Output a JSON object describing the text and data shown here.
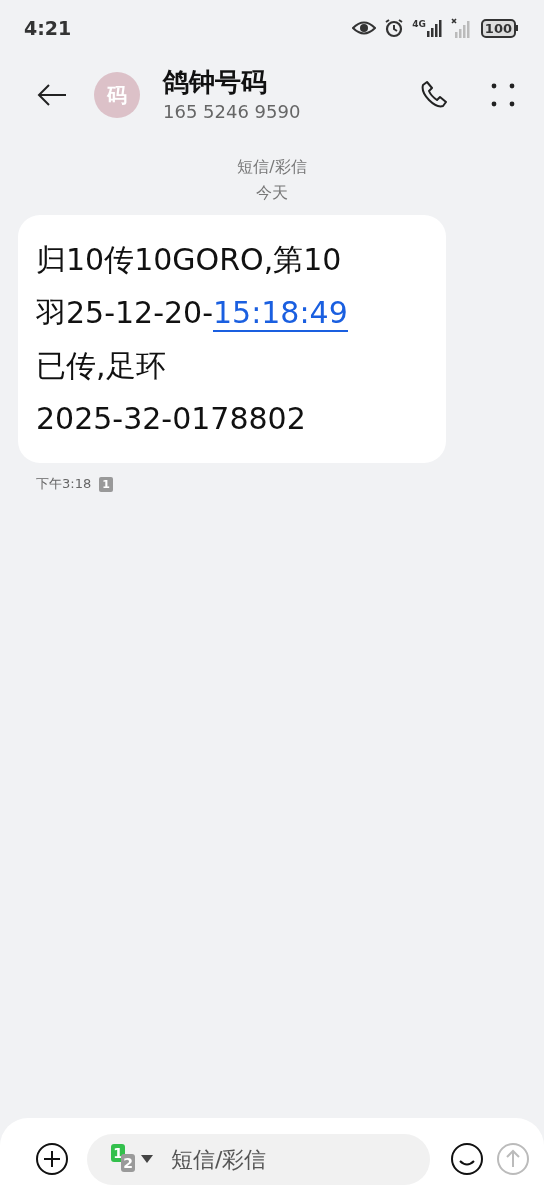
{
  "status_bar": {
    "time": "4:21",
    "network": "4G",
    "battery": "100"
  },
  "header": {
    "avatar": "码",
    "name": "鸽钟号码",
    "number": "165 5246 9590"
  },
  "conversation": {
    "channel": "短信/彩信",
    "day": "今天",
    "messages": [
      {
        "lines": [
          [
            {
              "kind": "text",
              "text": "归10传10GORO,第10"
            }
          ],
          [
            {
              "kind": "text",
              "text": "羽25-12-20-"
            },
            {
              "kind": "link",
              "text": "15:18:49"
            }
          ],
          [
            {
              "kind": "text",
              "text": "已传,足环"
            }
          ],
          [
            {
              "kind": "text",
              "text": "2025-32-0178802"
            }
          ]
        ],
        "time": "下午3:18",
        "sim": "1"
      }
    ]
  },
  "composer": {
    "sim_primary": "1",
    "sim_secondary": "2",
    "placeholder": "短信/彩信",
    "send_disabled": true
  }
}
